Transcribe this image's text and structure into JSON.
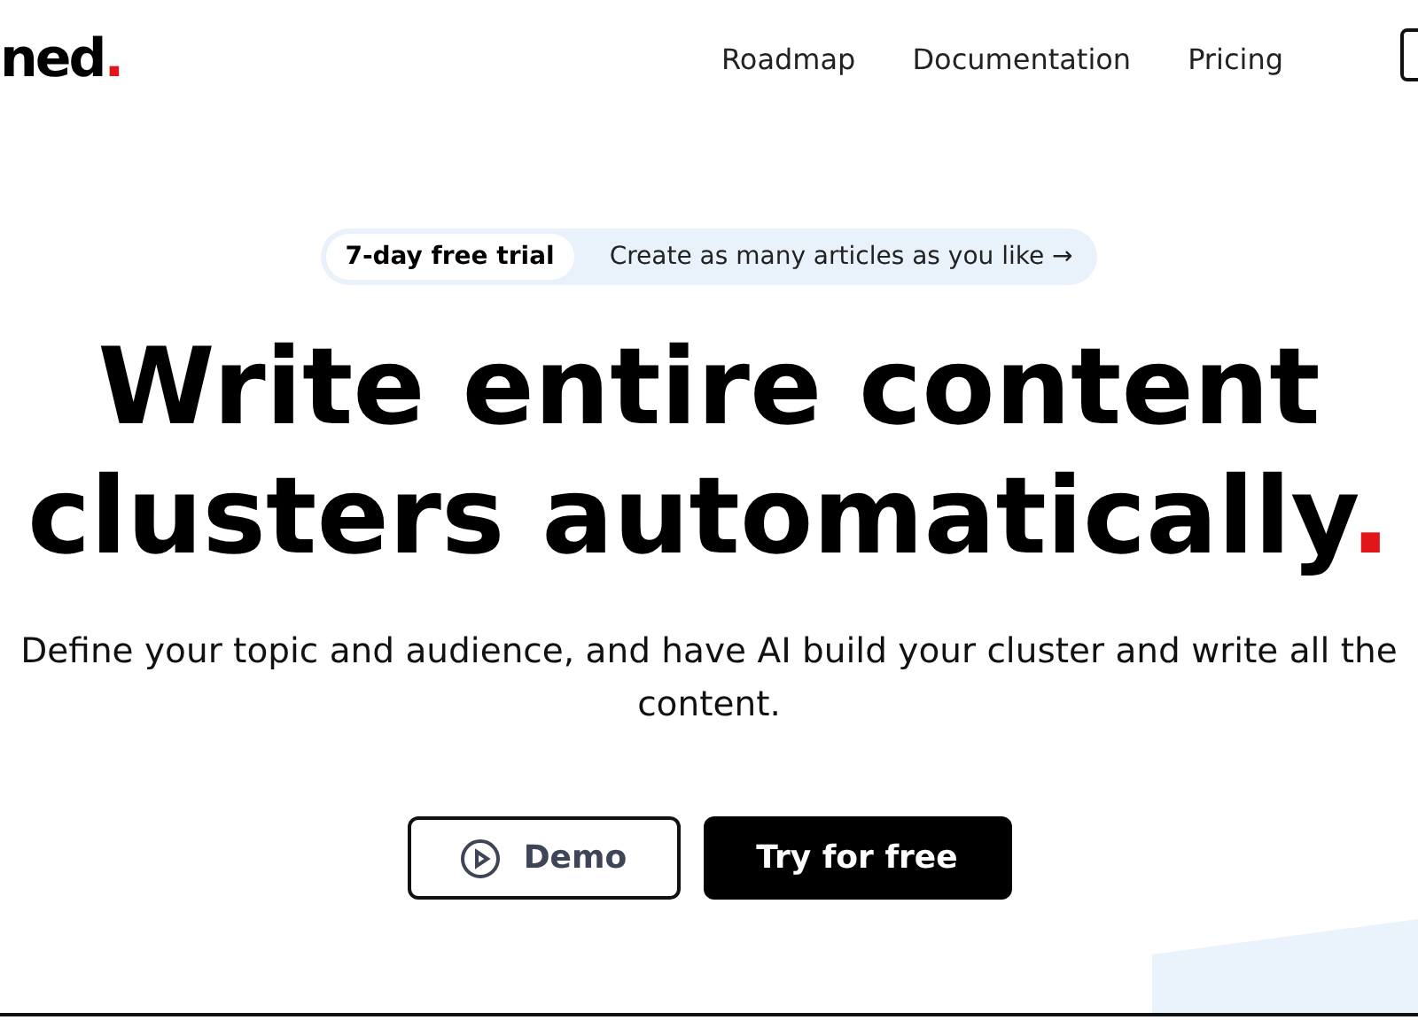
{
  "logo": {
    "text": "ned",
    "dot": "."
  },
  "nav": [
    {
      "label": "Roadmap"
    },
    {
      "label": "Documentation"
    },
    {
      "label": "Pricing"
    }
  ],
  "announcement": {
    "badge": "7-day free trial",
    "text": "Create as many articles as you like",
    "arrow": "→"
  },
  "headline": {
    "lines": [
      "Write entire content",
      "clusters automatically"
    ],
    "dot": "."
  },
  "subtitle": "Define your topic and audience, and have AI build your cluster and write all the content.",
  "buttons": [
    {
      "label": "Demo",
      "kind": "outline"
    },
    {
      "label": "Try for free",
      "kind": "primary"
    }
  ]
}
